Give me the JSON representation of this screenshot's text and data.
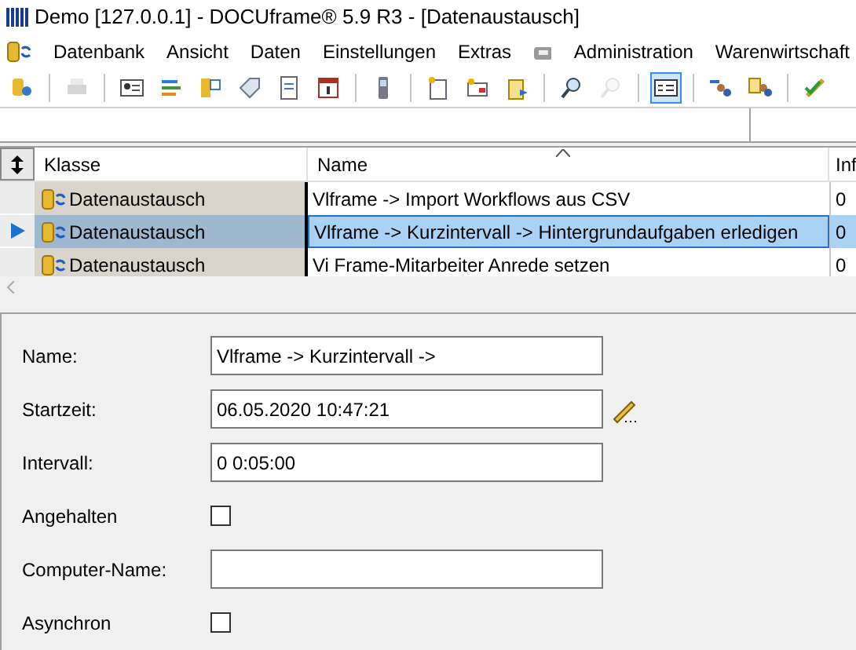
{
  "window": {
    "title": "Demo [127.0.0.1] - DOCUframe® 5.9 R3 - [Datenaustausch]"
  },
  "menu": [
    {
      "kind": "text",
      "label": "Datenbank"
    },
    {
      "kind": "text",
      "label": "Ansicht"
    },
    {
      "kind": "text",
      "label": "Daten"
    },
    {
      "kind": "text",
      "label": "Einstellungen"
    },
    {
      "kind": "text",
      "label": "Extras"
    },
    {
      "kind": "icon"
    },
    {
      "kind": "text",
      "label": "Administration"
    },
    {
      "kind": "text",
      "label": "Warenwirtschaft"
    }
  ],
  "toolbar": [
    {
      "kind": "icon",
      "disabled": false,
      "selected": false
    },
    {
      "kind": "separator"
    },
    {
      "kind": "icon",
      "disabled": true,
      "selected": false
    },
    {
      "kind": "separator"
    },
    {
      "kind": "icon",
      "disabled": false,
      "selected": false
    },
    {
      "kind": "icon",
      "disabled": false,
      "selected": false
    },
    {
      "kind": "icon",
      "disabled": false,
      "selected": false
    },
    {
      "kind": "icon",
      "disabled": false,
      "selected": false
    },
    {
      "kind": "icon",
      "disabled": false,
      "selected": false
    },
    {
      "kind": "icon",
      "disabled": false,
      "selected": false
    },
    {
      "kind": "separator"
    },
    {
      "kind": "icon",
      "disabled": false,
      "selected": false
    },
    {
      "kind": "separator"
    },
    {
      "kind": "icon",
      "disabled": false,
      "selected": false
    },
    {
      "kind": "icon",
      "disabled": false,
      "selected": false
    },
    {
      "kind": "icon",
      "disabled": false,
      "selected": false
    },
    {
      "kind": "separator"
    },
    {
      "kind": "icon",
      "disabled": false,
      "selected": false
    },
    {
      "kind": "icon",
      "disabled": true,
      "selected": false
    },
    {
      "kind": "separator"
    },
    {
      "kind": "icon",
      "disabled": false,
      "selected": true
    },
    {
      "kind": "separator"
    },
    {
      "kind": "icon",
      "disabled": false,
      "selected": false
    },
    {
      "kind": "icon",
      "disabled": false,
      "selected": false
    },
    {
      "kind": "separator"
    },
    {
      "kind": "icon",
      "disabled": false,
      "selected": false
    }
  ],
  "table": {
    "columns": [
      "Klasse",
      "Name",
      "Inf"
    ],
    "rows": [
      {
        "klasse": "Datenaustausch",
        "name": "Vlframe -> Import Workflows aus CSV",
        "column_3": "0",
        "selected": false
      },
      {
        "klasse": "Datenaustausch",
        "name": "Vlframe -> Kurzintervall -> Hintergrundaufgaben erledigen",
        "column_3": "0",
        "selected": true
      },
      {
        "klasse": "Datenaustausch",
        "name": "Vi Frame-Mitarbeiter Anrede setzen",
        "column_3": "0",
        "selected": false
      }
    ]
  },
  "form": [
    {
      "kind": "text",
      "label": "Name:",
      "value": "Vlframe -> Kurzintervall ->"
    },
    {
      "kind": "datetime",
      "label": "Startzeit:",
      "value": "06.05.2020 10:47:21"
    },
    {
      "kind": "text",
      "label": "Intervall:",
      "value": "0 0:05:00"
    },
    {
      "kind": "checkbox",
      "label": "Angehalten",
      "checked": false
    },
    {
      "kind": "text",
      "label": "Computer-Name:"
    },
    {
      "kind": "checkbox",
      "label": "Asynchron",
      "checked": false
    }
  ]
}
